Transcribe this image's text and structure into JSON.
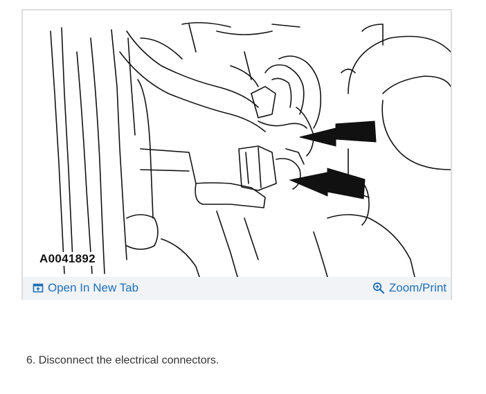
{
  "figure": {
    "id_label": "A0041892",
    "open_tab_label": "Open In New Tab",
    "zoom_label": "Zoom/Print",
    "link_color": "#1f6fb5",
    "toolbar_bg": "#f1f3f6",
    "open_icon": "open-new-tab-icon",
    "zoom_icon": "zoom-magnifier-icon"
  },
  "instruction": {
    "step_text": "6. Disconnect the electrical connectors."
  }
}
